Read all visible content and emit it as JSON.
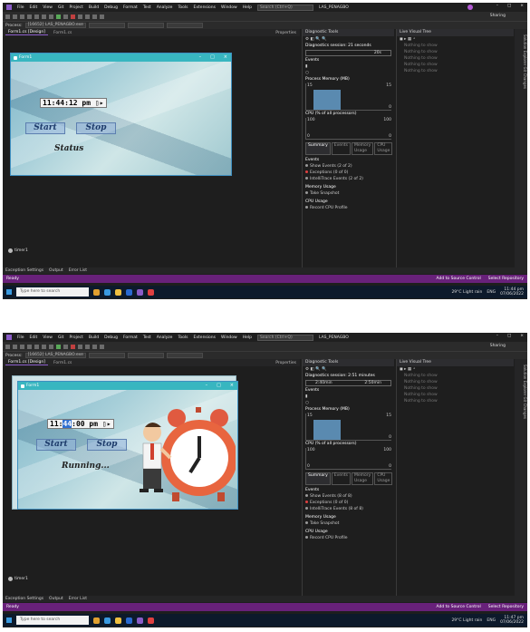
{
  "menu": {
    "items": [
      "File",
      "Edit",
      "View",
      "Git",
      "Project",
      "Build",
      "Debug",
      "Format",
      "Test",
      "Analyze",
      "Tools",
      "Extensions",
      "Window",
      "Help"
    ],
    "search_placeholder": "Search (Ctrl+Q)",
    "solution_name": "LAS_PENAGBO",
    "live_share": "Sharing"
  },
  "process_label": "Process:",
  "process_value": "[16652] LAS_PENAGBO.exe",
  "tabs": {
    "active": "Form1.cs [Design]",
    "second": "Form1.cs",
    "properties": "Properties"
  },
  "bottom_tabs": [
    "Exception Settings",
    "Output",
    "Error List"
  ],
  "component_tray": {
    "timer": "timer1"
  },
  "form_title": "Form1",
  "screens": [
    {
      "clock": {
        "hh": "11",
        "mm": "44",
        "ss": "12",
        "ampm": "pm"
      },
      "start_label": "Start",
      "stop_label": "Stop",
      "status_label": "Status",
      "diag_session": "Diagnostics session: 21 seconds",
      "time_marker": "20s",
      "time_start": "",
      "taskbar_time": "11:44 pm",
      "taskbar_date": "07/06/2022"
    },
    {
      "clock": {
        "hh": "11",
        "mm": "44",
        "ss": "00",
        "ampm": "pm"
      },
      "start_label": "Start",
      "stop_label": "Stop",
      "status_label": "Running...",
      "diag_session": "Diagnostics session: 2:51 minutes",
      "time_marker": "2:50min",
      "time_start": "2:40min",
      "taskbar_time": "11:47 pm",
      "taskbar_date": "07/06/2022"
    }
  ],
  "diagnostics": {
    "title": "Diagnostic Tools",
    "events": "Events",
    "process_memory": "Process Memory (MB)",
    "mem_max": "15",
    "mem_min": "0",
    "cpu": "CPU (% of all processors)",
    "cpu_max": "100",
    "cpu_min": "0",
    "tabs": [
      "Summary",
      "Events",
      "Memory Usage",
      "CPU Usage"
    ],
    "events_section": "Events",
    "show_events": [
      "Show Events (2 of 2)",
      "Show Events (8 of 8)"
    ],
    "exceptions": "Exceptions (0 of 0)",
    "intellitrace": [
      "IntelliTrace Events (2 of 2)",
      "IntelliTrace Events (8 of 8)"
    ],
    "memory_usage": "Memory Usage",
    "take_snapshot": "Take Snapshot",
    "cpu_usage": "CPU Usage",
    "record_cpu": "Record CPU Profile"
  },
  "live_tree": {
    "title": "Live Visual Tree",
    "rows": [
      "Nothing to show",
      "Nothing to show",
      "Nothing to show",
      "Nothing to show",
      "Nothing to show"
    ]
  },
  "side_tabs": [
    "Solution Explorer",
    "Git Changes"
  ],
  "statusbar": {
    "ready": "Ready",
    "source_control": "Add to Source Control",
    "repository": "Select Repository"
  },
  "taskbar": {
    "search": "Type here to search",
    "weather": "29°C Light rain",
    "lang": "ENG"
  },
  "colors": {
    "vs_purple": "#68217a",
    "form_title": "#38b6c0",
    "accent": "#8a5cc8"
  }
}
